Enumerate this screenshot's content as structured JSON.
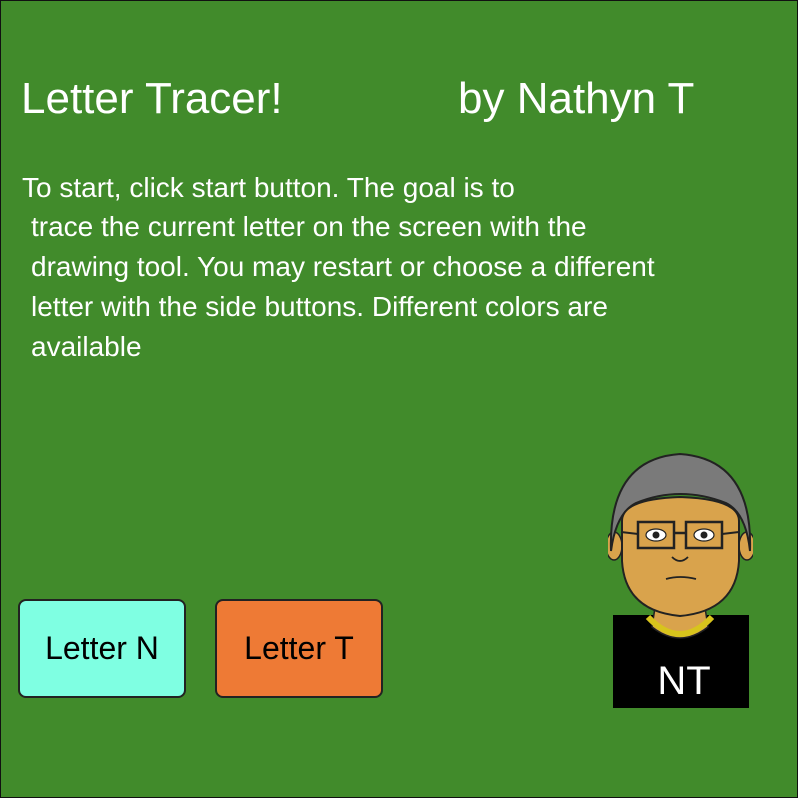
{
  "title": "Letter Tracer!",
  "byline": "by Nathyn T",
  "instructions": [
    "To start, click start button. The goal is to",
    "trace the current letter on the screen with the",
    "drawing tool. You may restart or choose a different",
    "letter with the side buttons. Different colors are",
    "available"
  ],
  "buttons": {
    "letter_n": {
      "label": "Letter N",
      "color": "#7fffe2"
    },
    "letter_t": {
      "label": "Letter T",
      "color": "#ee7a35"
    }
  },
  "avatar": {
    "initials": "NT"
  },
  "colors": {
    "background": "#418b2b",
    "text": "#ffffff"
  }
}
